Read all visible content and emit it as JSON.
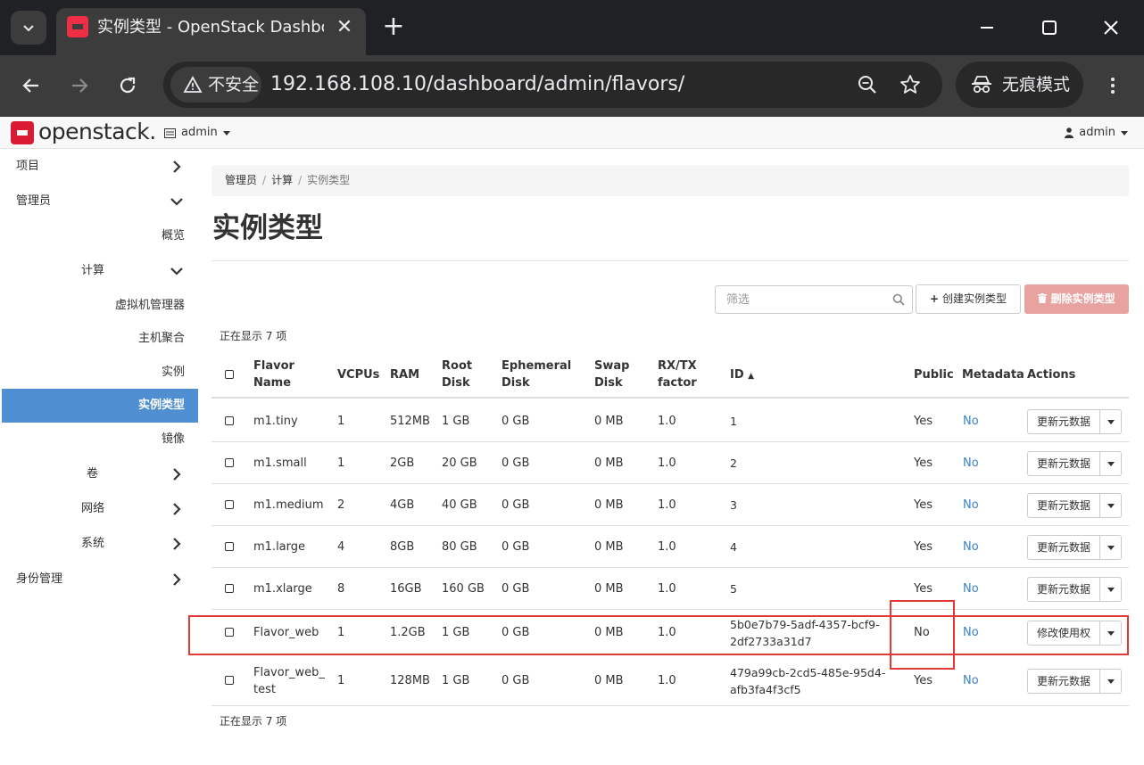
{
  "browser": {
    "tab_title": "实例类型 - OpenStack Dashboard",
    "security_label": "不安全",
    "url": "192.168.108.10/dashboard/admin/flavors/",
    "incognito_label": "无痕模式"
  },
  "header": {
    "logo_text": "openstack.",
    "project": "admin",
    "user": "admin"
  },
  "sidebar": {
    "items": [
      {
        "label": "项目"
      },
      {
        "label": "管理员"
      },
      {
        "label": "概览"
      },
      {
        "label": "计算"
      },
      {
        "label": "虚拟机管理器"
      },
      {
        "label": "主机聚合"
      },
      {
        "label": "实例"
      },
      {
        "label": "实例类型",
        "active": true
      },
      {
        "label": "镜像"
      },
      {
        "label": "卷"
      },
      {
        "label": "网络"
      },
      {
        "label": "系统"
      },
      {
        "label": "身份管理"
      }
    ]
  },
  "breadcrumb": [
    "管理员",
    "计算",
    "实例类型"
  ],
  "page_title": "实例类型",
  "filter": {
    "placeholder": "筛选"
  },
  "buttons": {
    "create": "创建实例类型",
    "delete": "删除实例类型"
  },
  "count_text": "正在显示 7 项",
  "table": {
    "columns": {
      "name_1": "Flavor",
      "name_2": "Name",
      "vcpus": "VCPUs",
      "ram": "RAM",
      "root_1": "Root",
      "root_2": "Disk",
      "eph_1": "Ephemeral",
      "eph_2": "Disk",
      "swap_1": "Swap",
      "swap_2": "Disk",
      "rxtx_1": "RX/TX",
      "rxtx_2": "factor",
      "id": "ID",
      "public": "Public",
      "metadata": "Metadata",
      "actions": "Actions"
    },
    "rows": [
      {
        "name_1": "m1.tiny",
        "name_2": "",
        "vcpus": "1",
        "ram": "512MB",
        "root": "1 GB",
        "eph": "0 GB",
        "swap": "0 MB",
        "rxtx": "1.0",
        "id_1": "1",
        "id_2": "",
        "public": "Yes",
        "metadata": "No",
        "action": "更新元数据"
      },
      {
        "name_1": "m1.small",
        "name_2": "",
        "vcpus": "1",
        "ram": "2GB",
        "root": "20 GB",
        "eph": "0 GB",
        "swap": "0 MB",
        "rxtx": "1.0",
        "id_1": "2",
        "id_2": "",
        "public": "Yes",
        "metadata": "No",
        "action": "更新元数据"
      },
      {
        "name_1": "m1.medium",
        "name_2": "",
        "vcpus": "2",
        "ram": "4GB",
        "root": "40 GB",
        "eph": "0 GB",
        "swap": "0 MB",
        "rxtx": "1.0",
        "id_1": "3",
        "id_2": "",
        "public": "Yes",
        "metadata": "No",
        "action": "更新元数据"
      },
      {
        "name_1": "m1.large",
        "name_2": "",
        "vcpus": "4",
        "ram": "8GB",
        "root": "80 GB",
        "eph": "0 GB",
        "swap": "0 MB",
        "rxtx": "1.0",
        "id_1": "4",
        "id_2": "",
        "public": "Yes",
        "metadata": "No",
        "action": "更新元数据"
      },
      {
        "name_1": "m1.xlarge",
        "name_2": "",
        "vcpus": "8",
        "ram": "16GB",
        "root": "160 GB",
        "eph": "0 GB",
        "swap": "0 MB",
        "rxtx": "1.0",
        "id_1": "5",
        "id_2": "",
        "public": "Yes",
        "metadata": "No",
        "action": "更新元数据"
      },
      {
        "name_1": "Flavor_web",
        "name_2": "",
        "vcpus": "1",
        "ram": "1.2GB",
        "root": "1 GB",
        "eph": "0 GB",
        "swap": "0 MB",
        "rxtx": "1.0",
        "id_1": "5b0e7b79-5adf-4357-bcf9-",
        "id_2": "2df2733a31d7",
        "public": "No",
        "metadata": "No",
        "action": "修改使用权"
      },
      {
        "name_1": "Flavor_web_",
        "name_2": "test",
        "vcpus": "1",
        "ram": "128MB",
        "root": "1 GB",
        "eph": "0 GB",
        "swap": "0 MB",
        "rxtx": "1.0",
        "id_1": "479a99cb-2cd5-485e-95d4-",
        "id_2": "afb3fa4f3cf5",
        "public": "Yes",
        "metadata": "No",
        "action": "更新元数据"
      }
    ]
  },
  "colors": {
    "accent": "#4f8ed0",
    "link": "#3a83c7",
    "danger": "#e8a3a0",
    "annotation": "#e53935"
  }
}
